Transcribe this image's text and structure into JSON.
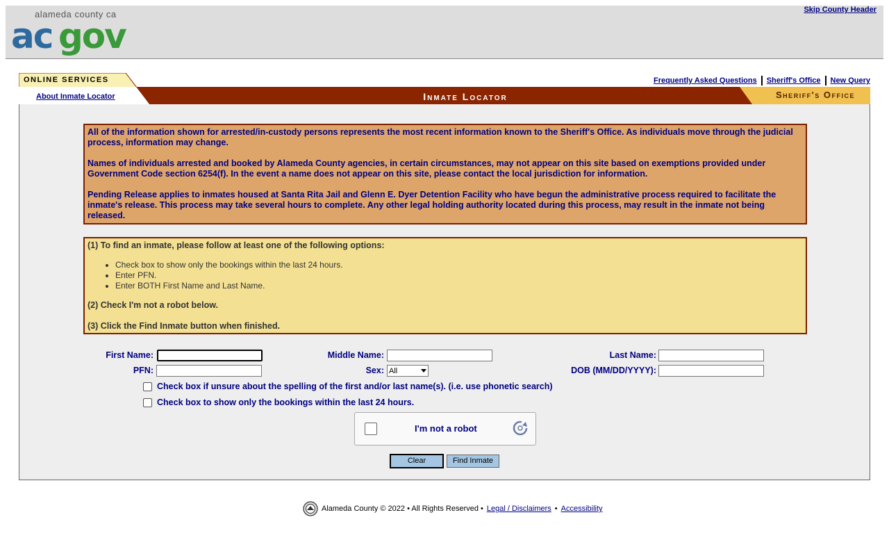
{
  "header": {
    "logo_subtitle": "alameda county ca",
    "logo_text": "acgov",
    "skip_link": "Skip County Header"
  },
  "nav": {
    "online_services": "ONLINE SERVICES",
    "about_link": "About Inmate Locator",
    "links": [
      "Frequently Asked Questions",
      "Sheriff's Office",
      "New Query"
    ]
  },
  "banner": {
    "title": "Inmate Locator",
    "department": "Sheriff's Office"
  },
  "notice": {
    "paragraphs": [
      "All of the information shown for arrested/in-custody persons represents the most recent information known to the Sheriff's Office.  As individuals move through the judicial process, information may change.",
      "Names of individuals arrested and booked by Alameda County agencies, in certain circumstances, may not appear on this site based on exemptions provided under Government Code section 6254(f).  In the event a name does not appear on this site, please contact the local jurisdiction for information.",
      "Pending Release applies to inmates housed at Santa Rita Jail and Glenn E. Dyer Detention Facility who have begun the administrative process required to facilitate the inmate's release.  This process may take several hours to complete.  Any other legal holding authority located during this process, may result in the inmate not being released."
    ]
  },
  "instructions": {
    "step1": "(1) To find an inmate, please follow at least one of the following options:",
    "options": [
      "Check box to show only the bookings within the last 24 hours.",
      "Enter PFN.",
      "Enter BOTH First Name and Last Name."
    ],
    "step2": "(2) Check I'm not a robot below.",
    "step3": "(3) Click the Find Inmate button when finished."
  },
  "form": {
    "first_name_label": "First Name:",
    "middle_name_label": "Middle Name:",
    "last_name_label": "Last Name:",
    "pfn_label": "PFN:",
    "sex_label": "Sex:",
    "sex_value": "All",
    "dob_label": "DOB (MM/DD/YYYY):",
    "first_name_value": "",
    "middle_name_value": "",
    "last_name_value": "",
    "pfn_value": "",
    "dob_value": "",
    "phonetic_label": "Check box if unsure about the spelling of the first and/or last name(s). (i.e. use phonetic search)",
    "last24_label": "Check box to show only the bookings within the last 24 hours.",
    "phonetic_checked": false,
    "last24_checked": false
  },
  "captcha": {
    "label": "I'm not a robot"
  },
  "buttons": {
    "clear": "Clear",
    "find": "Find Inmate"
  },
  "footer": {
    "copyright": "Alameda County © 2022 • All Rights Reserved •",
    "legal_link": "Legal / Disclaimers",
    "separator": "•",
    "accessibility_link": "Accessibility"
  },
  "colors": {
    "banner_dark": "#8b2500",
    "banner_gold": "#f0c050",
    "notice_bg": "#dea56a",
    "instructions_bg": "#f3e092",
    "link_navy": "#000080",
    "logo_blue": "#2e6a9e",
    "logo_green": "#3a9a3a"
  }
}
